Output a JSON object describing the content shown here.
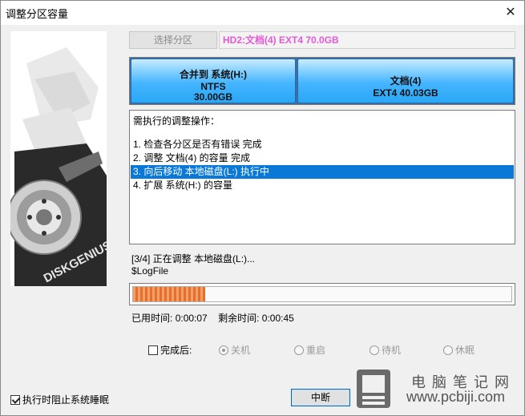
{
  "window": {
    "title": "调整分区容量",
    "close_glyph": "✕"
  },
  "header": {
    "select_partition_label": "选择分区",
    "disk_info": "HD2:文档(4) EXT4 70.0GB",
    "disk_info_color": "#e45ad6"
  },
  "partitions": [
    {
      "name": "合并到 系统(H:)",
      "fs": "NTFS",
      "size": "30.00GB"
    },
    {
      "name": "文档(4)",
      "fs": "EXT4 40.03GB",
      "size": ""
    }
  ],
  "operations": {
    "title": "需执行的调整操作：",
    "items": [
      "1. 检查各分区是否有错误     完成",
      "2. 调整 文档(4) 的容量     完成",
      "3. 向后移动 本地磁盘(L:)     执行中",
      "4. 扩展 系统(H:) 的容量"
    ],
    "selected_index": 2
  },
  "progress": {
    "status": "[3/4] 正在调整 本地磁盘(L:)...",
    "file": "$LogFile",
    "fraction": 0.19,
    "elapsed_label": "已用时间:",
    "elapsed": "0:00:07",
    "remaining_label": "剩余时间:",
    "remaining": "0:00:45"
  },
  "after_completion": {
    "label": "完成后:",
    "checked": false,
    "options": [
      "关机",
      "重启",
      "待机",
      "休眠"
    ],
    "selected": "关机"
  },
  "footer": {
    "prevent_sleep_label": "执行时阻止系统睡眠",
    "prevent_sleep_checked": true,
    "abort_label": "中断"
  },
  "watermark": {
    "cn": "电脑笔记网",
    "url": "www.pcbiji.com"
  },
  "side_image": {
    "brand": "DISKGENIUS"
  }
}
